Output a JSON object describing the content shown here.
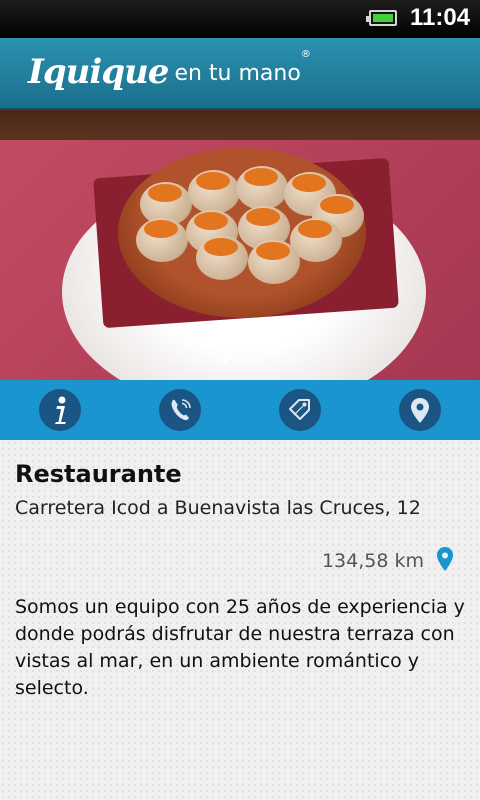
{
  "status_bar": {
    "time": "11:04",
    "battery_icon": "battery-full-icon"
  },
  "header": {
    "logo_script": "Iquique",
    "logo_rest": "en tu mano",
    "logo_mark": "®",
    "color": "#2387a8"
  },
  "gallery": {
    "page_count": 3,
    "current_page": 1
  },
  "actions": [
    {
      "icon": "info-icon"
    },
    {
      "icon": "phone-icon"
    },
    {
      "icon": "tag-icon"
    },
    {
      "icon": "map-pin-icon"
    }
  ],
  "place": {
    "title": "Restaurante",
    "address": "Carretera Icod a Buenavista las Cruces, 12",
    "distance": "134,58 km",
    "description": "Somos un equipo con 25 años de experiencia y donde podrás disfrutar de nuestra terraza con vistas al mar, en un ambiente romántico y selecto."
  },
  "colors": {
    "action_bar": "#1a95cf",
    "action_icon_bg": "#1a5584",
    "pin": "#1a95cf"
  }
}
